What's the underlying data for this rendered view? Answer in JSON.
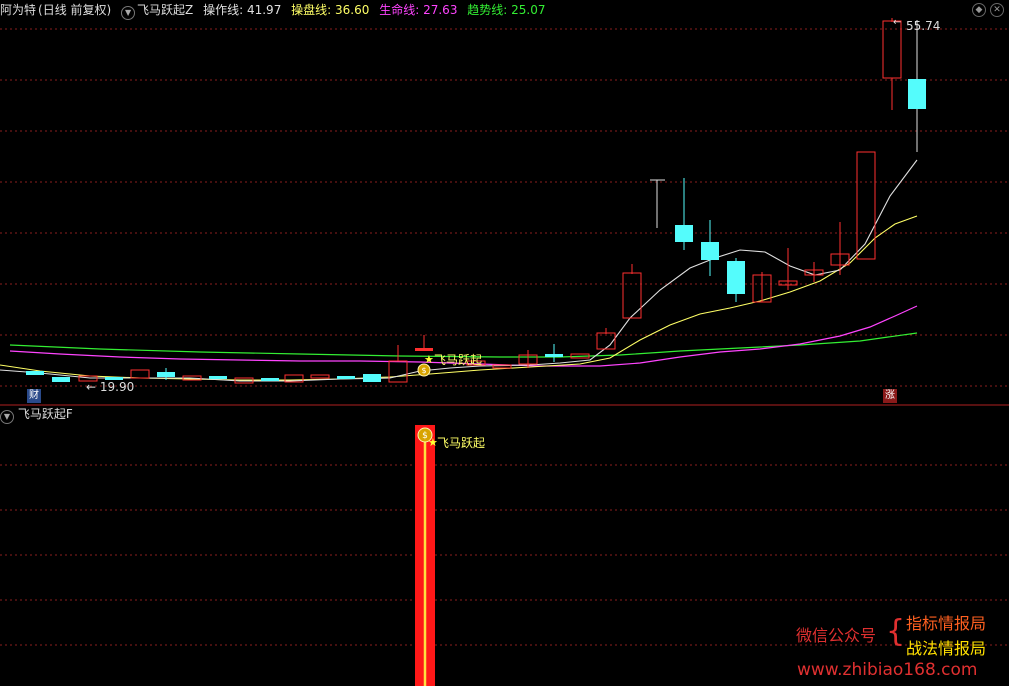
{
  "header": {
    "stock_name": "阿为特",
    "period": "(日线 前复权)",
    "indicator_name": "飞马跃起Z",
    "lines": [
      {
        "label": "操作线:",
        "value": "41.97",
        "color": "#e0e0e0"
      },
      {
        "label": "操盘线:",
        "value": "36.60",
        "color": "#ffff66"
      },
      {
        "label": "生命线:",
        "value": "27.63",
        "color": "#ff44ff"
      },
      {
        "label": "趋势线:",
        "value": "25.07",
        "color": "#33ee33"
      }
    ]
  },
  "main_panel": {
    "high_label": "55.74",
    "low_label": "19.90",
    "signal_label": "飞马跃起",
    "badge_left": "财",
    "badge_right": "涨"
  },
  "sub_panel": {
    "indicator_name": "飞马跃起F",
    "signal_label": "飞马跃起"
  },
  "watermark": {
    "wechat": "微信公众号",
    "brand1": "指标情报局",
    "brand2": "战法情报局",
    "url": "www.zhibiao168.com"
  },
  "colors": {
    "up": "#ff3030",
    "down": "#54fcfc",
    "grid": "#8a1e1e",
    "ma_operate": "#e0e0e0",
    "ma_trade": "#ffff66",
    "ma_life": "#ff44ff",
    "ma_trend": "#33ee33"
  }
}
